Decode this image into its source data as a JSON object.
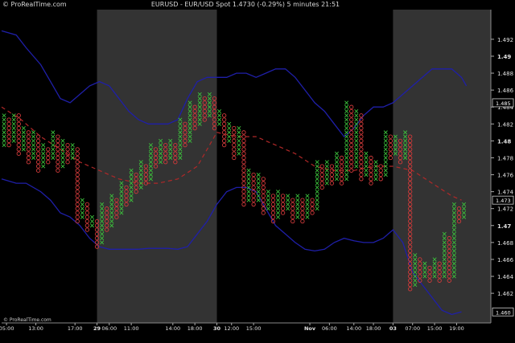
{
  "header": {
    "brand": "© ProRealTime.com",
    "title": "EURUSD - EUR/USD Spot    1.4730 (-0.29%)    5 minutes  21:51"
  },
  "footer_brand": "© ProRealTime.com",
  "colors": {
    "background": "#000000",
    "shade": "#333333",
    "band": "#1f1fa8",
    "average": "#b02828",
    "x_marker": "#3cc03c",
    "o_marker": "#d03a3a",
    "axis_text": "#e0e0e0"
  },
  "chart_data": {
    "type": "point-and-figure",
    "title": "EURUSD - EUR/USD Spot",
    "ylim": [
      1.4585,
      1.4955
    ],
    "ytick_values": [
      1.462,
      1.464,
      1.466,
      1.468,
      1.47,
      1.472,
      1.474,
      1.476,
      1.478,
      1.48,
      1.482,
      1.484,
      1.486,
      1.488,
      1.49,
      1.492
    ],
    "ytick_labels": [
      "1.462",
      "1.464",
      "1.466",
      "1.468",
      "1.47",
      "1.472",
      "1.474",
      "1.476",
      "1.478",
      "1.48",
      "1.482",
      "1.484",
      "1.486",
      "1.488",
      "1.49",
      "1.492"
    ],
    "bold_ticks": [
      "1.47",
      "1.48",
      "1.49"
    ],
    "last_price_label": "1.473",
    "upper_band_label": "1.485",
    "lower_band_label": "1.460",
    "xlim": [
      0,
      100
    ],
    "x_ticks": [
      {
        "x": 1,
        "label": "05:00",
        "bold": false
      },
      {
        "x": 7,
        "label": "13:00",
        "bold": false
      },
      {
        "x": 15,
        "label": "17:00",
        "bold": false
      },
      {
        "x": 19.5,
        "label": "29",
        "bold": true
      },
      {
        "x": 22,
        "label": "06:00",
        "bold": false
      },
      {
        "x": 26.5,
        "label": "11:00",
        "bold": false
      },
      {
        "x": 35,
        "label": "14:00",
        "bold": false
      },
      {
        "x": 39.5,
        "label": "18:00",
        "bold": false
      },
      {
        "x": 44,
        "label": "30",
        "bold": true
      },
      {
        "x": 47,
        "label": "12:00",
        "bold": false
      },
      {
        "x": 51.5,
        "label": "15:00",
        "bold": false
      },
      {
        "x": 63,
        "label": "Nov",
        "bold": true
      },
      {
        "x": 67,
        "label": "06:00",
        "bold": false
      },
      {
        "x": 72,
        "label": "14:00",
        "bold": false
      },
      {
        "x": 76,
        "label": "18:00",
        "bold": false
      },
      {
        "x": 80,
        "label": "03",
        "bold": true
      },
      {
        "x": 84,
        "label": "07:00",
        "bold": false
      },
      {
        "x": 88.5,
        "label": "15:00",
        "bold": false
      },
      {
        "x": 93,
        "label": "19:00",
        "bold": false
      }
    ],
    "shaded_sessions": [
      [
        19.5,
        44
      ],
      [
        80,
        100
      ]
    ],
    "upper_band": [
      [
        0,
        1.493
      ],
      [
        3,
        1.4925
      ],
      [
        5,
        1.491
      ],
      [
        8,
        1.489
      ],
      [
        10,
        1.487
      ],
      [
        12,
        1.485
      ],
      [
        14,
        1.4845
      ],
      [
        16,
        1.4855
      ],
      [
        18,
        1.4865
      ],
      [
        20,
        1.487
      ],
      [
        22,
        1.4865
      ],
      [
        24,
        1.485
      ],
      [
        26,
        1.4835
      ],
      [
        28,
        1.4825
      ],
      [
        30,
        1.482
      ],
      [
        32,
        1.482
      ],
      [
        34,
        1.482
      ],
      [
        36,
        1.4825
      ],
      [
        38,
        1.485
      ],
      [
        40,
        1.487
      ],
      [
        42,
        1.4875
      ],
      [
        44,
        1.4875
      ],
      [
        46,
        1.4875
      ],
      [
        48,
        1.488
      ],
      [
        50,
        1.488
      ],
      [
        52,
        1.4875
      ],
      [
        54,
        1.488
      ],
      [
        56,
        1.4885
      ],
      [
        58,
        1.4885
      ],
      [
        60,
        1.4875
      ],
      [
        62,
        1.486
      ],
      [
        64,
        1.4845
      ],
      [
        66,
        1.4835
      ],
      [
        68,
        1.482
      ],
      [
        70,
        1.4805
      ],
      [
        72,
        1.4815
      ],
      [
        74,
        1.483
      ],
      [
        76,
        1.484
      ],
      [
        78,
        1.484
      ],
      [
        80,
        1.4845
      ],
      [
        82,
        1.4855
      ],
      [
        84,
        1.4865
      ],
      [
        86,
        1.4875
      ],
      [
        88,
        1.4885
      ],
      [
        90,
        1.4885
      ],
      [
        92,
        1.4885
      ],
      [
        94,
        1.4875
      ],
      [
        95,
        1.4865
      ]
    ],
    "lower_band": [
      [
        0,
        1.4755
      ],
      [
        3,
        1.475
      ],
      [
        5,
        1.475
      ],
      [
        8,
        1.474
      ],
      [
        10,
        1.473
      ],
      [
        12,
        1.4715
      ],
      [
        14,
        1.471
      ],
      [
        16,
        1.47
      ],
      [
        18,
        1.4685
      ],
      [
        20,
        1.4675
      ],
      [
        22,
        1.4672
      ],
      [
        24,
        1.4672
      ],
      [
        26,
        1.4672
      ],
      [
        28,
        1.4672
      ],
      [
        30,
        1.4673
      ],
      [
        32,
        1.4673
      ],
      [
        34,
        1.4673
      ],
      [
        36,
        1.4672
      ],
      [
        38,
        1.4675
      ],
      [
        40,
        1.469
      ],
      [
        42,
        1.4705
      ],
      [
        44,
        1.4725
      ],
      [
        46,
        1.474
      ],
      [
        48,
        1.4745
      ],
      [
        50,
        1.4745
      ],
      [
        52,
        1.474
      ],
      [
        54,
        1.472
      ],
      [
        56,
        1.47
      ],
      [
        58,
        1.469
      ],
      [
        60,
        1.468
      ],
      [
        62,
        1.4672
      ],
      [
        64,
        1.467
      ],
      [
        66,
        1.4672
      ],
      [
        68,
        1.468
      ],
      [
        70,
        1.4685
      ],
      [
        72,
        1.4682
      ],
      [
        74,
        1.468
      ],
      [
        76,
        1.468
      ],
      [
        78,
        1.4685
      ],
      [
        80,
        1.4695
      ],
      [
        82,
        1.468
      ],
      [
        84,
        1.4645
      ],
      [
        86,
        1.463
      ],
      [
        88,
        1.4615
      ],
      [
        90,
        1.46
      ],
      [
        92,
        1.4595
      ],
      [
        94,
        1.4598
      ]
    ],
    "moving_average": [
      [
        0,
        1.484
      ],
      [
        4,
        1.4825
      ],
      [
        8,
        1.4805
      ],
      [
        12,
        1.479
      ],
      [
        16,
        1.4775
      ],
      [
        20,
        1.4765
      ],
      [
        24,
        1.4755
      ],
      [
        28,
        1.475
      ],
      [
        32,
        1.475
      ],
      [
        36,
        1.4755
      ],
      [
        40,
        1.477
      ],
      [
        42,
        1.479
      ],
      [
        44,
        1.481
      ],
      [
        48,
        1.4805
      ],
      [
        52,
        1.4805
      ],
      [
        56,
        1.4795
      ],
      [
        60,
        1.4785
      ],
      [
        64,
        1.477
      ],
      [
        68,
        1.4765
      ],
      [
        72,
        1.4765
      ],
      [
        76,
        1.477
      ],
      [
        80,
        1.477
      ],
      [
        84,
        1.4765
      ],
      [
        88,
        1.475
      ],
      [
        92,
        1.4735
      ],
      [
        94,
        1.473
      ]
    ],
    "pf_columns": [
      {
        "x": 0.5,
        "type": "X",
        "from": 1.4795,
        "to": 1.483
      },
      {
        "x": 1.5,
        "type": "O",
        "from": 1.4825,
        "to": 1.4795
      },
      {
        "x": 2.5,
        "type": "X",
        "from": 1.48,
        "to": 1.483
      },
      {
        "x": 3.5,
        "type": "O",
        "from": 1.483,
        "to": 1.4785
      },
      {
        "x": 4.5,
        "type": "X",
        "from": 1.479,
        "to": 1.4815
      },
      {
        "x": 5.5,
        "type": "O",
        "from": 1.481,
        "to": 1.4775
      },
      {
        "x": 6.5,
        "type": "X",
        "from": 1.478,
        "to": 1.481
      },
      {
        "x": 7.5,
        "type": "O",
        "from": 1.4805,
        "to": 1.4765
      },
      {
        "x": 8.5,
        "type": "X",
        "from": 1.477,
        "to": 1.4795
      },
      {
        "x": 9.5,
        "type": "O",
        "from": 1.479,
        "to": 1.4775
      },
      {
        "x": 10.5,
        "type": "X",
        "from": 1.478,
        "to": 1.481
      },
      {
        "x": 11.5,
        "type": "O",
        "from": 1.4805,
        "to": 1.4765
      },
      {
        "x": 12.5,
        "type": "X",
        "from": 1.477,
        "to": 1.48
      },
      {
        "x": 13.5,
        "type": "O",
        "from": 1.4795,
        "to": 1.4775
      },
      {
        "x": 14.5,
        "type": "X",
        "from": 1.478,
        "to": 1.4795
      },
      {
        "x": 15.5,
        "type": "O",
        "from": 1.479,
        "to": 1.4705
      },
      {
        "x": 16.5,
        "type": "X",
        "from": 1.471,
        "to": 1.473
      },
      {
        "x": 17.5,
        "type": "O",
        "from": 1.4725,
        "to": 1.4695
      },
      {
        "x": 18.5,
        "type": "X",
        "from": 1.47,
        "to": 1.471
      },
      {
        "x": 19.5,
        "type": "O",
        "from": 1.4705,
        "to": 1.4675
      },
      {
        "x": 20.5,
        "type": "X",
        "from": 1.468,
        "to": 1.4725
      },
      {
        "x": 21.5,
        "type": "O",
        "from": 1.472,
        "to": 1.4695
      },
      {
        "x": 22.5,
        "type": "X",
        "from": 1.47,
        "to": 1.4735
      },
      {
        "x": 23.5,
        "type": "O",
        "from": 1.473,
        "to": 1.471
      },
      {
        "x": 24.5,
        "type": "X",
        "from": 1.4715,
        "to": 1.475
      },
      {
        "x": 25.5,
        "type": "O",
        "from": 1.4745,
        "to": 1.4725
      },
      {
        "x": 26.5,
        "type": "X",
        "from": 1.473,
        "to": 1.4765
      },
      {
        "x": 27.5,
        "type": "O",
        "from": 1.476,
        "to": 1.474
      },
      {
        "x": 28.5,
        "type": "X",
        "from": 1.4745,
        "to": 1.4775
      },
      {
        "x": 29.5,
        "type": "O",
        "from": 1.477,
        "to": 1.475
      },
      {
        "x": 30.5,
        "type": "X",
        "from": 1.4755,
        "to": 1.4795
      },
      {
        "x": 31.5,
        "type": "O",
        "from": 1.479,
        "to": 1.477
      },
      {
        "x": 32.5,
        "type": "X",
        "from": 1.4775,
        "to": 1.48
      },
      {
        "x": 33.5,
        "type": "O",
        "from": 1.4795,
        "to": 1.4775
      },
      {
        "x": 34.5,
        "type": "X",
        "from": 1.478,
        "to": 1.48
      },
      {
        "x": 35.5,
        "type": "O",
        "from": 1.4795,
        "to": 1.4775
      },
      {
        "x": 36.5,
        "type": "X",
        "from": 1.478,
        "to": 1.4825
      },
      {
        "x": 37.5,
        "type": "O",
        "from": 1.482,
        "to": 1.4795
      },
      {
        "x": 38.5,
        "type": "X",
        "from": 1.48,
        "to": 1.4845
      },
      {
        "x": 39.5,
        "type": "O",
        "from": 1.484,
        "to": 1.4815
      },
      {
        "x": 40.5,
        "type": "X",
        "from": 1.482,
        "to": 1.4855
      },
      {
        "x": 41.5,
        "type": "O",
        "from": 1.485,
        "to": 1.4825
      },
      {
        "x": 42.5,
        "type": "X",
        "from": 1.483,
        "to": 1.4855
      },
      {
        "x": 43.5,
        "type": "O",
        "from": 1.485,
        "to": 1.4815
      },
      {
        "x": 44.5,
        "type": "X",
        "from": 1.482,
        "to": 1.4835
      },
      {
        "x": 45.5,
        "type": "O",
        "from": 1.483,
        "to": 1.4795
      },
      {
        "x": 46.5,
        "type": "X",
        "from": 1.48,
        "to": 1.482
      },
      {
        "x": 47.5,
        "type": "O",
        "from": 1.4815,
        "to": 1.478
      },
      {
        "x": 48.5,
        "type": "X",
        "from": 1.4785,
        "to": 1.4815
      },
      {
        "x": 49.5,
        "type": "O",
        "from": 1.481,
        "to": 1.4725
      },
      {
        "x": 50.5,
        "type": "X",
        "from": 1.473,
        "to": 1.4765
      },
      {
        "x": 51.5,
        "type": "O",
        "from": 1.476,
        "to": 1.4725
      },
      {
        "x": 52.5,
        "type": "X",
        "from": 1.473,
        "to": 1.476
      },
      {
        "x": 53.5,
        "type": "O",
        "from": 1.4755,
        "to": 1.4715
      },
      {
        "x": 54.5,
        "type": "X",
        "from": 1.472,
        "to": 1.474
      },
      {
        "x": 55.5,
        "type": "O",
        "from": 1.4735,
        "to": 1.4705
      },
      {
        "x": 56.5,
        "type": "X",
        "from": 1.471,
        "to": 1.474
      },
      {
        "x": 57.5,
        "type": "O",
        "from": 1.4735,
        "to": 1.4715
      },
      {
        "x": 58.5,
        "type": "X",
        "from": 1.472,
        "to": 1.4735
      },
      {
        "x": 59.5,
        "type": "O",
        "from": 1.473,
        "to": 1.4705
      },
      {
        "x": 60.5,
        "type": "X",
        "from": 1.471,
        "to": 1.4735
      },
      {
        "x": 61.5,
        "type": "O",
        "from": 1.473,
        "to": 1.4705
      },
      {
        "x": 62.5,
        "type": "X",
        "from": 1.471,
        "to": 1.4735
      },
      {
        "x": 63.5,
        "type": "O",
        "from": 1.473,
        "to": 1.4715
      },
      {
        "x": 64.5,
        "type": "X",
        "from": 1.472,
        "to": 1.4775
      },
      {
        "x": 65.5,
        "type": "O",
        "from": 1.477,
        "to": 1.4745
      },
      {
        "x": 66.5,
        "type": "X",
        "from": 1.475,
        "to": 1.4775
      },
      {
        "x": 67.5,
        "type": "O",
        "from": 1.477,
        "to": 1.475
      },
      {
        "x": 68.5,
        "type": "X",
        "from": 1.4755,
        "to": 1.4785
      },
      {
        "x": 69.5,
        "type": "O",
        "from": 1.478,
        "to": 1.475
      },
      {
        "x": 70.5,
        "type": "X",
        "from": 1.4755,
        "to": 1.4845
      },
      {
        "x": 71.5,
        "type": "O",
        "from": 1.484,
        "to": 1.4765
      },
      {
        "x": 72.5,
        "type": "X",
        "from": 1.477,
        "to": 1.4835
      },
      {
        "x": 73.5,
        "type": "O",
        "from": 1.483,
        "to": 1.4755
      },
      {
        "x": 74.5,
        "type": "X",
        "from": 1.476,
        "to": 1.4785
      },
      {
        "x": 75.5,
        "type": "O",
        "from": 1.478,
        "to": 1.475
      },
      {
        "x": 76.5,
        "type": "X",
        "from": 1.4755,
        "to": 1.4775
      },
      {
        "x": 77.5,
        "type": "O",
        "from": 1.477,
        "to": 1.4755
      },
      {
        "x": 78.5,
        "type": "X",
        "from": 1.476,
        "to": 1.481
      },
      {
        "x": 79.5,
        "type": "O",
        "from": 1.4805,
        "to": 1.478
      },
      {
        "x": 80.5,
        "type": "X",
        "from": 1.4785,
        "to": 1.4805
      },
      {
        "x": 81.5,
        "type": "O",
        "from": 1.48,
        "to": 1.4775
      },
      {
        "x": 82.5,
        "type": "X",
        "from": 1.478,
        "to": 1.481
      },
      {
        "x": 83.5,
        "type": "O",
        "from": 1.4805,
        "to": 1.4625
      },
      {
        "x": 84.5,
        "type": "X",
        "from": 1.463,
        "to": 1.4665
      },
      {
        "x": 85.5,
        "type": "O",
        "from": 1.466,
        "to": 1.4635
      },
      {
        "x": 86.5,
        "type": "X",
        "from": 1.464,
        "to": 1.4655
      },
      {
        "x": 87.5,
        "type": "O",
        "from": 1.465,
        "to": 1.4635
      },
      {
        "x": 88.5,
        "type": "X",
        "from": 1.464,
        "to": 1.466
      },
      {
        "x": 89.5,
        "type": "O",
        "from": 1.4655,
        "to": 1.4635
      },
      {
        "x": 90.5,
        "type": "X",
        "from": 1.464,
        "to": 1.469
      },
      {
        "x": 91.5,
        "type": "O",
        "from": 1.4685,
        "to": 1.4635
      },
      {
        "x": 92.5,
        "type": "X",
        "from": 1.464,
        "to": 1.4725
      },
      {
        "x": 93.5,
        "type": "O",
        "from": 1.472,
        "to": 1.4705
      },
      {
        "x": 94.5,
        "type": "X",
        "from": 1.471,
        "to": 1.4725
      }
    ]
  }
}
